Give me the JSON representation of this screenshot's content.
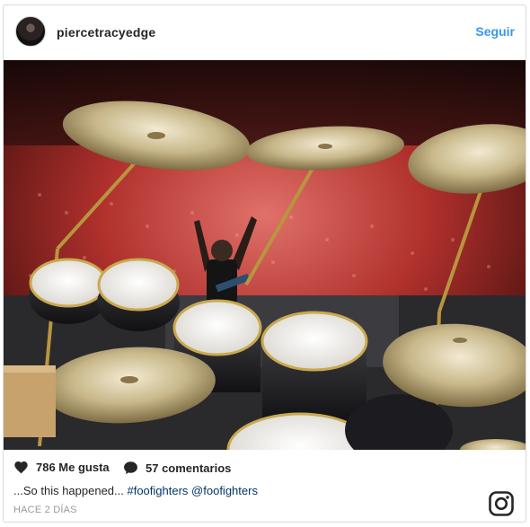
{
  "header": {
    "username": "piercetracyedge",
    "follow_label": "Seguir"
  },
  "photo": {
    "alt_hint": "concert stage drum kit photo"
  },
  "stats": {
    "likes": "786 Me gusta",
    "comments": "57 comentarios"
  },
  "caption": {
    "text_prefix": "...So this happened... ",
    "hashtag": "#foofighters",
    "mention": "@foofighters"
  },
  "timestamp": "HACE 2 DÍAS",
  "icons": {
    "likes": "heart-icon",
    "comments": "speech-bubble-icon",
    "brand": "instagram-logo-icon"
  },
  "colors": {
    "follow": "#3897f0",
    "text": "#262626",
    "muted": "#999999",
    "link": "#003569"
  }
}
